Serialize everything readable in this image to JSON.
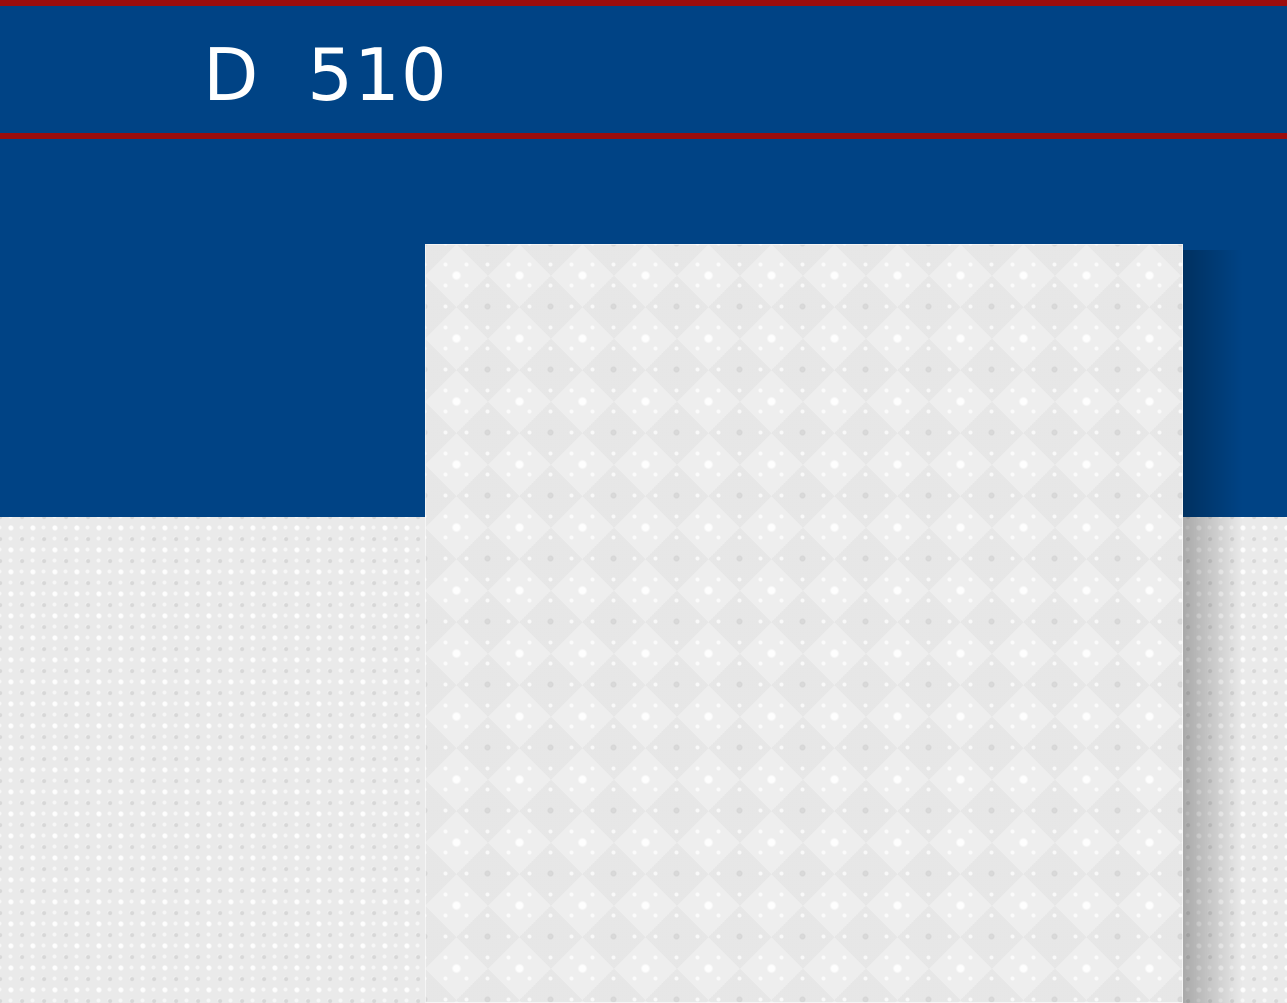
{
  "header": {
    "product_code": "D  510"
  },
  "colors": {
    "brand_blue": "#004385",
    "accent_red": "#9b0d0d",
    "tile_white": "#eeeeee"
  }
}
